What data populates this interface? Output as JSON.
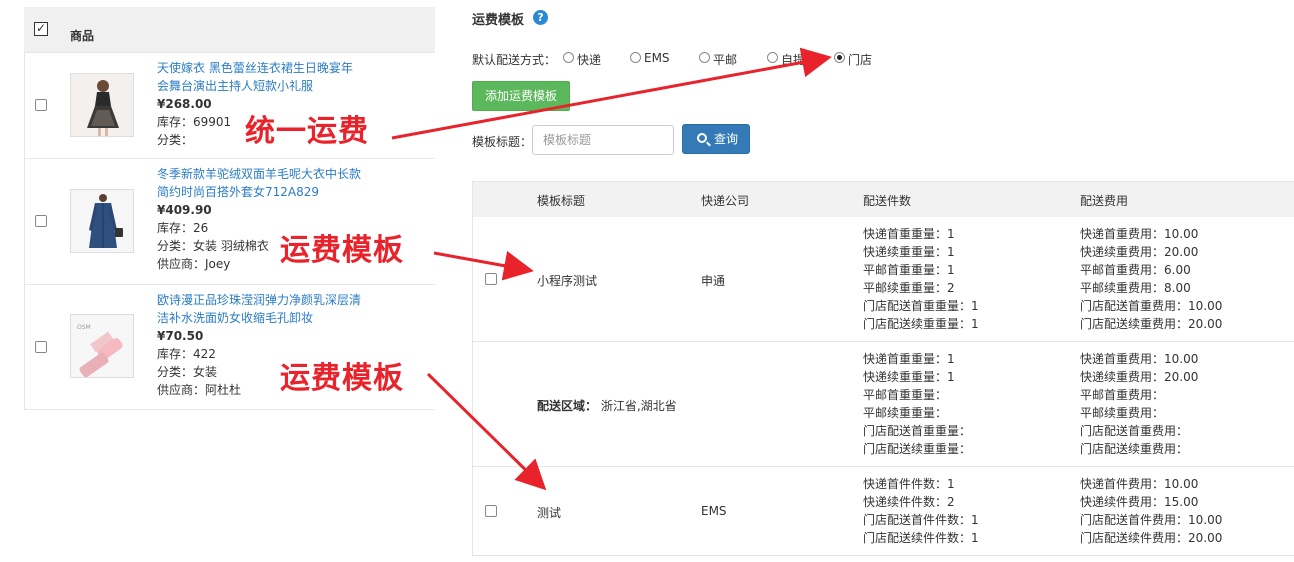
{
  "products": {
    "header": "商品",
    "items": [
      {
        "name": "天使嫁衣 黑色蕾丝连衣裙生日晚宴年会舞台演出主持人短款小礼服",
        "name_line1": "天使嫁衣 黑色蕾丝连衣裙生日晚宴年",
        "name_line2": "会舞台演出主持人短款小礼服",
        "price": "¥268.00",
        "stock": "库存：69901",
        "category": "分类：",
        "supplier": ""
      },
      {
        "name": "冬季新款羊驼绒双面羊毛呢大衣中长款简约时尚百搭外套女712A829",
        "name_line1": "冬季新款羊驼绒双面羊毛呢大衣中长款",
        "name_line2": "简约时尚百搭外套女712A829",
        "price": "¥409.90",
        "stock": "库存：26",
        "category": "分类：女装 羽绒棉衣",
        "supplier": "供应商：Joey"
      },
      {
        "name": "欧诗漫正品珍珠滢润弹力净颜乳深层清洁补水洗面奶女收缩毛孔卸妆",
        "name_line1": "欧诗漫正品珍珠滢润弹力净颜乳深层清",
        "name_line2": "洁补水洗面奶女收缩毛孔卸妆",
        "price": "¥70.50",
        "stock": "库存：422",
        "category": "分类：女装",
        "supplier": "供应商：阿杜杜"
      }
    ]
  },
  "panel": {
    "title": "运费模板",
    "help_icon": "question-circle-icon",
    "ship_label": "默认配送方式：",
    "ship_options": [
      "快递",
      "EMS",
      "平邮",
      "自提",
      "门店"
    ],
    "ship_selected": "门店",
    "add_button": "添加运费模板",
    "search_label": "模板标题：",
    "search_placeholder": "模板标题",
    "search_value": "",
    "query_button": "查询"
  },
  "table": {
    "columns": [
      "模板标题",
      "快递公司",
      "配送件数",
      "配送费用"
    ],
    "rows": [
      {
        "title": "小程序测试",
        "company": "申通",
        "counts": [
          "快递首重重量：1",
          "快递续重重量：1",
          "平邮首重重量：1",
          "平邮续重重量：2",
          "门店配送首重重量：1",
          "门店配送续重重量：1"
        ],
        "fees": [
          "快递首重费用：10.00",
          "快递续重费用：20.00",
          "平邮首重费用：6.00",
          "平邮续重费用：8.00",
          "门店配送首重费用：10.00",
          "门店配送续重费用：20.00"
        ]
      },
      {
        "region_label": "配送区域：",
        "region_value": "浙江省,湖北省",
        "counts": [
          "快递首重重量：1",
          "快递续重重量：1",
          "平邮首重重量：",
          "平邮续重重量：",
          "门店配送首重重量：",
          "门店配送续重重量："
        ],
        "fees": [
          "快递首重费用：10.00",
          "快递续重费用：20.00",
          "平邮首重费用：",
          "平邮续重费用：",
          "门店配送首重费用：",
          "门店配送续重费用："
        ]
      },
      {
        "title": "测试",
        "company": "EMS",
        "counts": [
          "快递首件件数：1",
          "快递续件件数：2",
          "门店配送首件件数：1",
          "门店配送续件件数：1"
        ],
        "fees": [
          "快递首件费用：10.00",
          "快递续件费用：15.00",
          "门店配送首件费用：10.00",
          "门店配送续件费用：20.00"
        ]
      }
    ]
  },
  "annotations": [
    "统一运费",
    "运费模板",
    "运费模板"
  ],
  "colors": {
    "link_blue": "#2a7cc7",
    "add_green": "#5cb85c",
    "query_blue": "#337ab7",
    "annotation_red": "#e8232b"
  }
}
